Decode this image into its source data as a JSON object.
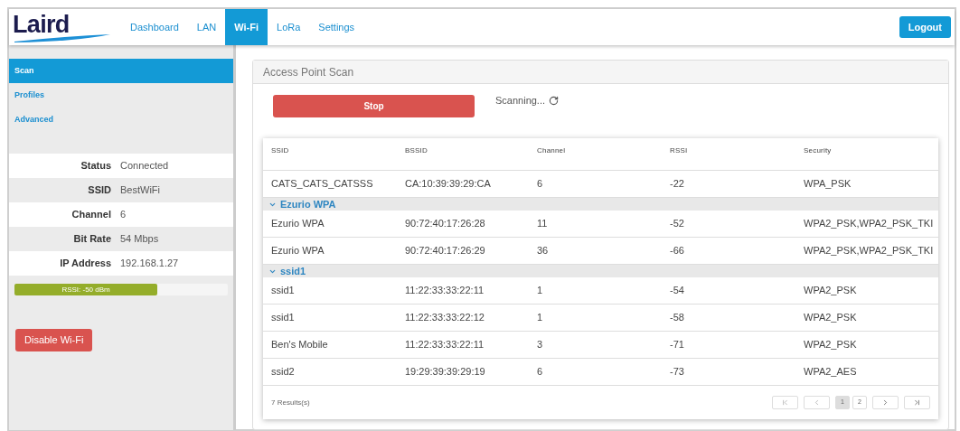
{
  "header": {
    "logo": "Laird",
    "nav": [
      {
        "label": "Dashboard",
        "selected": false
      },
      {
        "label": "LAN",
        "selected": false
      },
      {
        "label": "Wi-Fi",
        "selected": true
      },
      {
        "label": "LoRa",
        "selected": false
      },
      {
        "label": "Settings",
        "selected": false
      }
    ],
    "logout": "Logout"
  },
  "sidebar": {
    "items": [
      {
        "label": "Scan",
        "selected": true
      },
      {
        "label": "Profiles",
        "selected": false
      },
      {
        "label": "Advanced",
        "selected": false
      }
    ],
    "info": [
      {
        "label": "Status",
        "value": "Connected"
      },
      {
        "label": "SSID",
        "value": "BestWiFi"
      },
      {
        "label": "Channel",
        "value": "6"
      },
      {
        "label": "Bit Rate",
        "value": "54 Mbps"
      },
      {
        "label": "IP Address",
        "value": "192.168.1.27"
      }
    ],
    "rssi": {
      "reading": "RSSI: -50 dBm",
      "level": 0.67
    },
    "disable_button": "Disable Wi-Fi"
  },
  "panel": {
    "title": "Access Point Scan",
    "stop_button": "Stop",
    "status": "Scanning...",
    "table": {
      "columns": [
        "SSID",
        "BSSID",
        "Channel",
        "RSSI",
        "Security"
      ],
      "rows": [
        {
          "kind": "row",
          "cells": [
            "CATS_CATS_CATSSS",
            "CA:10:39:39:29:CA",
            "6",
            "-22",
            "WPA_PSK"
          ]
        },
        {
          "kind": "group",
          "label": "Ezurio WPA",
          "expanded": true
        },
        {
          "kind": "row",
          "cells": [
            "Ezurio WPA",
            "90:72:40:17:26:28",
            "11",
            "-52",
            "WPA2_PSK,WPA2_PSK_TKI"
          ]
        },
        {
          "kind": "row",
          "cells": [
            "Ezurio WPA",
            "90:72:40:17:26:29",
            "36",
            "-66",
            "WPA2_PSK,WPA2_PSK_TKI"
          ]
        },
        {
          "kind": "group",
          "label": "ssid1",
          "expanded": true
        },
        {
          "kind": "row",
          "cells": [
            "ssid1",
            "11:22:33:33:22:11",
            "1",
            "-54",
            "WPA2_PSK"
          ]
        },
        {
          "kind": "row",
          "cells": [
            "ssid1",
            "11:22:33:33:22:12",
            "1",
            "-58",
            "WPA2_PSK"
          ]
        },
        {
          "kind": "row",
          "cells": [
            "Ben's Mobile",
            "11:22:33:33:22:11",
            "3",
            "-71",
            "WPA2_PSK"
          ]
        },
        {
          "kind": "row",
          "cells": [
            "ssid2",
            "19:29:39:39:29:19",
            "6",
            "-73",
            "WPA2_AES"
          ]
        }
      ],
      "results": "7 Results(s)",
      "pages": [
        {
          "label": "1",
          "selected": true
        },
        {
          "label": "2",
          "selected": false
        }
      ]
    }
  }
}
